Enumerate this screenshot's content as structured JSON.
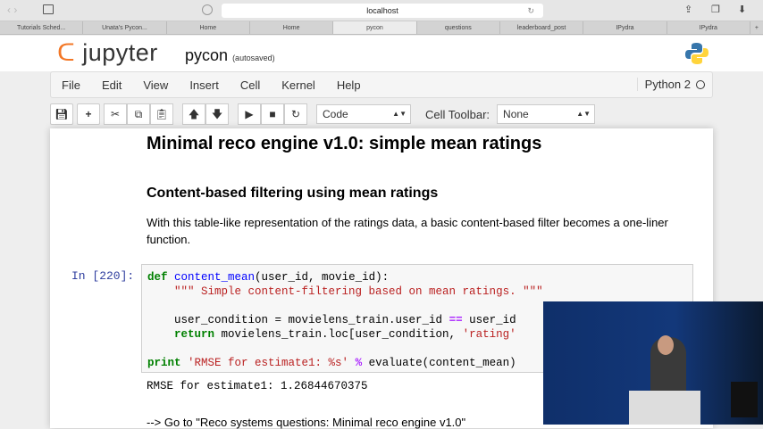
{
  "browser": {
    "url": "localhost",
    "tabs": [
      "Tutorials Sched...",
      "Unata's Pycon...",
      "Home",
      "Home",
      "pycon",
      "questions",
      "leaderboard_post",
      "IPydra",
      "IPydra"
    ],
    "active_tab": 4,
    "new_tab": "+"
  },
  "header": {
    "logo": "jupyter",
    "notebook_name": "pycon",
    "save_status": "(autosaved)"
  },
  "menu": [
    "File",
    "Edit",
    "View",
    "Insert",
    "Cell",
    "Kernel",
    "Help"
  ],
  "kernel": "Python 2",
  "toolbar": {
    "cell_type": "Code",
    "cell_toolbar_label": "Cell Toolbar:",
    "cell_toolbar_value": "None"
  },
  "notebook": {
    "h1": "Minimal reco engine v1.0: simple mean ratings",
    "h2": "Content-based filtering using mean ratings",
    "paragraph": "With this table-like representation of the ratings data, a basic content-based filter becomes a one-liner function.",
    "prompt": "In [220]:",
    "code": {
      "l1a": "def",
      "l1b": "content_mean",
      "l1c": "(user_id, movie_id):",
      "l2": "    \"\"\" Simple content-filtering based on mean ratings. \"\"\"",
      "l4a": "    user_condition = movielens_train.user_id ",
      "l4b": "==",
      "l4c": " user_id",
      "l5a": "    return",
      "l5b": " movielens_train.loc[user_condition, ",
      "l5c": "'rating'",
      "l7a": "print",
      "l7b": "'RMSE for estimate1: %s'",
      "l7c": "%",
      "l7d": " evaluate(content_mean)"
    },
    "output": "RMSE for estimate1: 1.26844670375",
    "link": "--> Go to \"Reco systems questions: Minimal reco engine v1.0\""
  }
}
